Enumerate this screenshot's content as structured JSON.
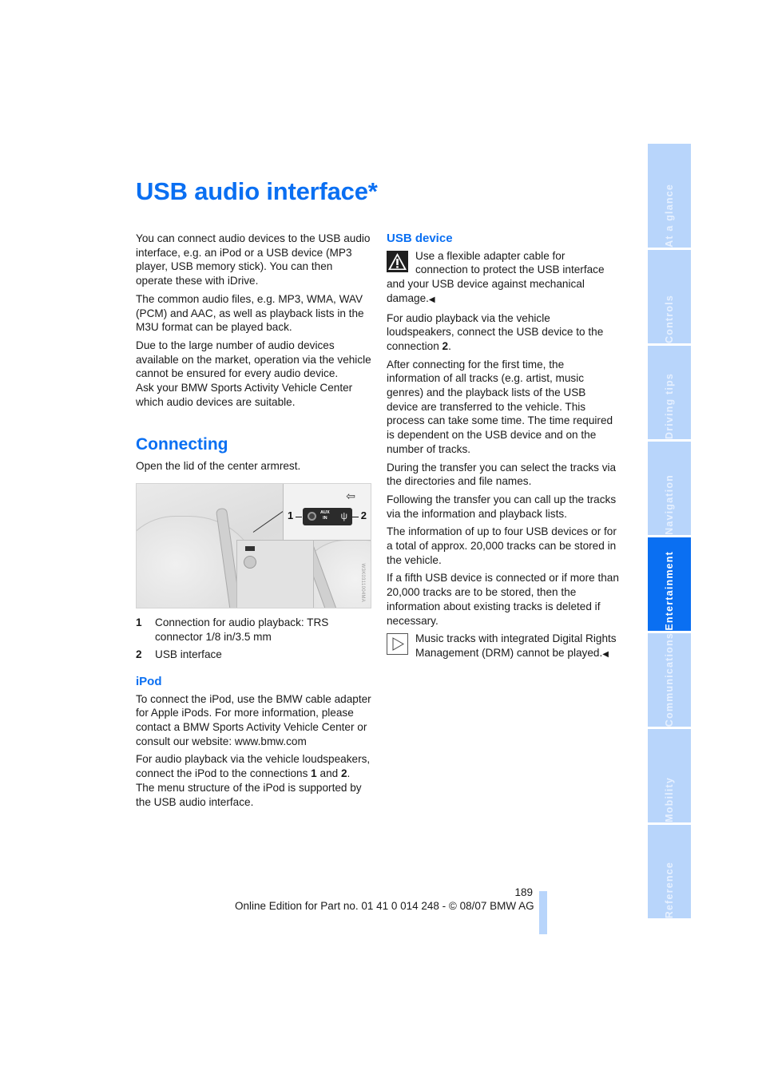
{
  "page": {
    "title": "USB audio interface*",
    "page_number": "189",
    "footer": "Online Edition for Part no. 01 41 0 014 248 - © 08/07 BMW AG"
  },
  "left_column": {
    "intro": [
      "You can connect audio devices to the USB audio interface, e.g. an iPod or a USB device (MP3 player, USB memory stick). You can then operate these with iDrive.",
      "The common audio files, e.g. MP3, WMA, WAV (PCM) and AAC, as well as playback lists in the M3U format can be played back.",
      "Due to the large number of audio devices available on the market, operation via the vehicle cannot be ensured for every audio device.",
      "Ask your BMW Sports Activity Vehicle Center which audio devices are suitable."
    ],
    "connecting": {
      "heading": "Connecting",
      "instruction": "Open the lid of the center armrest.",
      "figure": {
        "callout_1": "1",
        "callout_2": "2",
        "panel_label_line1": "AUX",
        "panel_label_line2": "IN",
        "usb_icon": "usb-symbol",
        "arrow_icon": "arrow-left-icon",
        "code": "W3K0311004MA"
      },
      "legend": [
        {
          "num": "1",
          "text": "Connection for audio playback: TRS connector 1/8 in/3.5 mm"
        },
        {
          "num": "2",
          "text": "USB interface"
        }
      ]
    },
    "ipod": {
      "heading": "iPod",
      "p1": "To connect the iPod, use the BMW cable adapter for Apple iPods. For more information, please contact a BMW Sports Activity Vehicle Center or consult our website: www.bmw.com",
      "p2_prefix": "For audio playback via the vehicle loudspeakers, connect the iPod to the connections ",
      "p2_bold1": "1",
      "p2_mid": " and ",
      "p2_bold2": "2",
      "p2_suffix": ".",
      "p3": "The menu structure of the iPod is supported by the USB audio interface."
    }
  },
  "right_column": {
    "usb_device": {
      "heading": "USB device",
      "warning": "Use a flexible adapter cable for connection to protect the USB interface and your USB device against mechanical damage.",
      "end_mark": "◀",
      "p1_prefix": "For audio playback via the vehicle loudspeakers, connect the USB device to the connection ",
      "p1_bold": "2",
      "p1_suffix": ".",
      "paragraphs": [
        "After connecting for the first time, the information of all tracks (e.g. artist, music genres) and the playback lists of the USB device are transferred to the vehicle. This process can take some time. The time required is dependent on the USB device and on the number of tracks.",
        "During the transfer you can select the tracks via the directories and file names.",
        "Following the transfer you can call up the tracks via the information and playback lists.",
        "The information of up to four USB devices or for a total of approx. 20,000 tracks can be stored in the vehicle.",
        "If a fifth USB device is connected or if more than 20,000 tracks are to be stored, then the information about existing tracks is deleted if necessary."
      ],
      "note": "Music tracks with integrated Digital Rights Management (DRM) cannot be played."
    }
  },
  "side_tabs": {
    "active": "Entertainment",
    "items": [
      {
        "label": "At a glance"
      },
      {
        "label": "Controls"
      },
      {
        "label": "Driving tips"
      },
      {
        "label": "Navigation"
      },
      {
        "label": "Entertainment"
      },
      {
        "label": "Communications"
      },
      {
        "label": "Mobility"
      },
      {
        "label": "Reference"
      }
    ]
  },
  "colors": {
    "accent": "#0a6ff2",
    "tab_inactive": "#b8d5fb"
  }
}
